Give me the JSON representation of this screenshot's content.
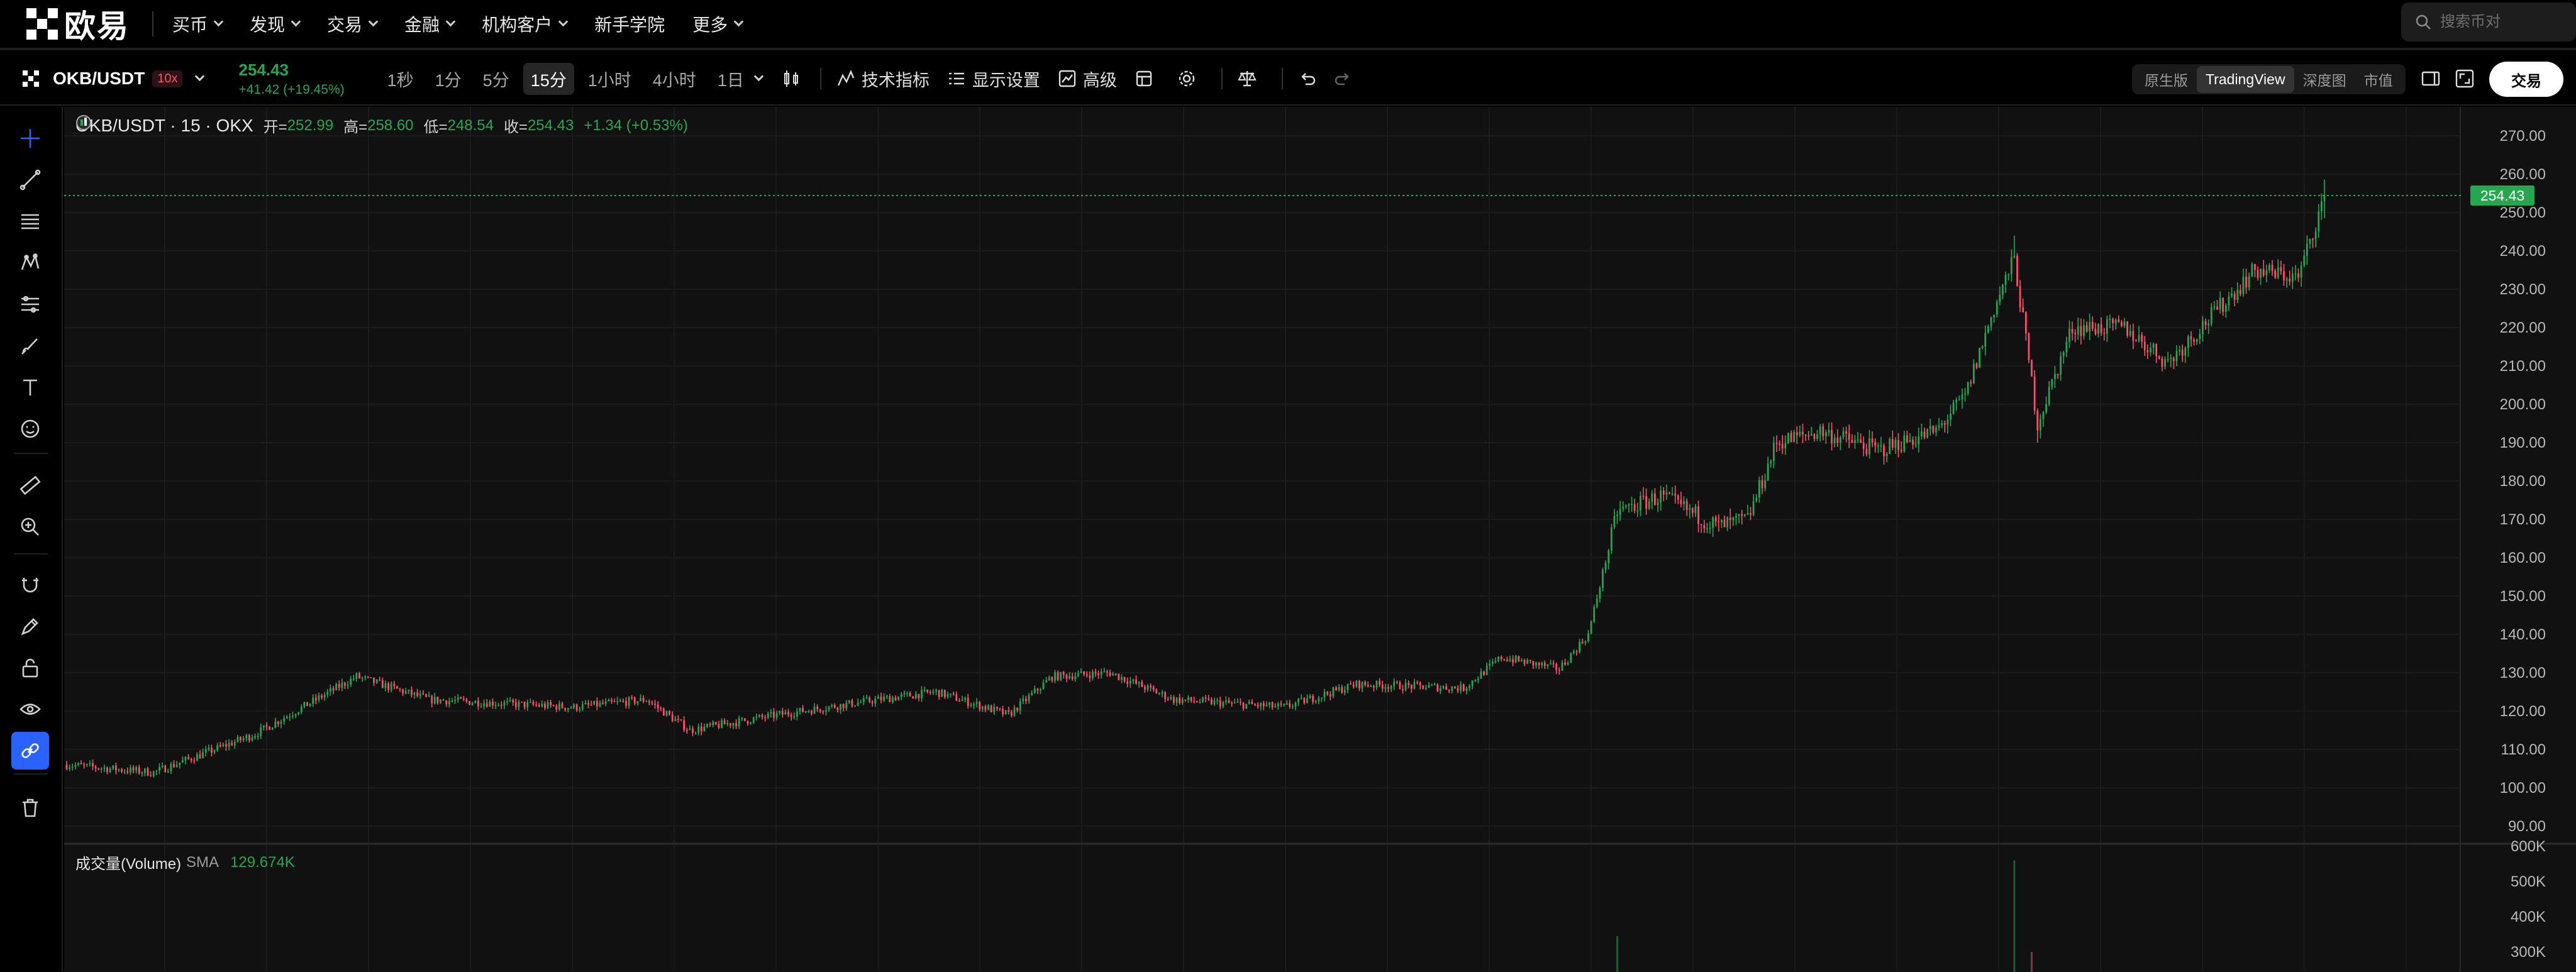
{
  "brand": {
    "name": "欧易"
  },
  "nav": {
    "items": [
      {
        "label": "买币",
        "dropdown": true
      },
      {
        "label": "发现",
        "dropdown": true
      },
      {
        "label": "交易",
        "dropdown": true
      },
      {
        "label": "金融",
        "dropdown": true
      },
      {
        "label": "机构客户",
        "dropdown": true
      },
      {
        "label": "新手学院",
        "dropdown": false
      },
      {
        "label": "更多",
        "dropdown": true
      }
    ],
    "search_placeholder": "搜索币对"
  },
  "toolbar": {
    "pair": "OKB/USDT",
    "leverage": "10x",
    "last_price": "254.43",
    "price_change": "+41.42 (+19.45%)",
    "intervals": [
      "1秒",
      "1分",
      "5分",
      "15分",
      "1小时",
      "4小时",
      "1日"
    ],
    "active_interval": "15分",
    "indicators_label": "技术指标",
    "display_settings_label": "显示设置",
    "advanced_label": "高级",
    "views": [
      "原生版",
      "TradingView",
      "深度图",
      "市值"
    ],
    "active_view": "TradingView",
    "trade_button": "交易"
  },
  "legend": {
    "symbol": "OKB/USDT · 15 · OKX",
    "open_label": "开=",
    "open": "252.99",
    "high_label": "高=",
    "high": "258.60",
    "low_label": "低=",
    "low": "248.54",
    "close_label": "收=",
    "close": "254.43",
    "change": "+1.34 (+0.53%)"
  },
  "volume_legend": {
    "title": "成交量(Volume)",
    "sma_label": "SMA",
    "value": "129.674K"
  },
  "price_axis": {
    "ticks": [
      "270.00",
      "260.00",
      "250.00",
      "240.00",
      "230.00",
      "220.00",
      "210.00",
      "200.00",
      "190.00",
      "180.00",
      "170.00",
      "160.00",
      "150.00",
      "140.00",
      "130.00",
      "120.00",
      "110.00",
      "100.00",
      "90.00"
    ],
    "current_price_label": "254.43"
  },
  "volume_axis": {
    "ticks": [
      "600K",
      "500K",
      "400K",
      "300K"
    ]
  },
  "left_tools": [
    "crosshair-icon",
    "trendline-icon",
    "fib-icon",
    "pattern-icon",
    "projection-icon",
    "brush-icon",
    "text-icon",
    "emoji-icon",
    "ruler-icon",
    "zoom-in-icon",
    "magnet-icon",
    "lock-draw-icon",
    "lock-icon",
    "eye-icon",
    "link-icon",
    "trash-icon"
  ],
  "colors": {
    "up": "#25a750",
    "down": "#ff4d6a",
    "background": "#111111",
    "accent": "#2962ff"
  },
  "chart_data": {
    "type": "candlestick",
    "symbol": "OKB/USDT",
    "interval": "15分",
    "y_range": [
      88,
      272
    ],
    "volume_range": [
      0,
      600
    ],
    "key_points": [
      {
        "i": 0,
        "close": 106
      },
      {
        "i": 30,
        "close": 104
      },
      {
        "i": 65,
        "close": 114
      },
      {
        "i": 100,
        "close": 129
      },
      {
        "i": 125,
        "close": 123
      },
      {
        "i": 175,
        "close": 121
      },
      {
        "i": 200,
        "close": 123
      },
      {
        "i": 215,
        "close": 115
      },
      {
        "i": 245,
        "close": 119
      },
      {
        "i": 280,
        "close": 123
      },
      {
        "i": 300,
        "close": 125
      },
      {
        "i": 325,
        "close": 119
      },
      {
        "i": 340,
        "close": 129
      },
      {
        "i": 360,
        "close": 130
      },
      {
        "i": 382,
        "close": 123
      },
      {
        "i": 420,
        "close": 121
      },
      {
        "i": 445,
        "close": 127
      },
      {
        "i": 482,
        "close": 126
      },
      {
        "i": 495,
        "close": 134
      },
      {
        "i": 515,
        "close": 131
      },
      {
        "i": 525,
        "close": 140
      },
      {
        "i": 535,
        "close": 172
      },
      {
        "i": 550,
        "close": 176
      },
      {
        "i": 570,
        "close": 168
      },
      {
        "i": 580,
        "close": 170
      },
      {
        "i": 590,
        "close": 190
      },
      {
        "i": 605,
        "close": 193
      },
      {
        "i": 625,
        "close": 188
      },
      {
        "i": 645,
        "close": 193
      },
      {
        "i": 655,
        "close": 202
      },
      {
        "i": 665,
        "close": 225
      },
      {
        "i": 672,
        "close": 238
      },
      {
        "i": 680,
        "close": 195
      },
      {
        "i": 692,
        "close": 220
      },
      {
        "i": 710,
        "close": 220
      },
      {
        "i": 725,
        "close": 211
      },
      {
        "i": 740,
        "close": 223
      },
      {
        "i": 755,
        "close": 235
      },
      {
        "i": 770,
        "close": 233
      },
      {
        "i": 779,
        "close": 254.43
      }
    ],
    "last": {
      "open": 252.99,
      "high": 258.6,
      "low": 248.54,
      "close": 254.43
    },
    "volume_spikes": [
      {
        "i": 535,
        "volume": 345
      },
      {
        "i": 672,
        "volume": 560
      },
      {
        "i": 678,
        "volume": 300
      }
    ]
  }
}
